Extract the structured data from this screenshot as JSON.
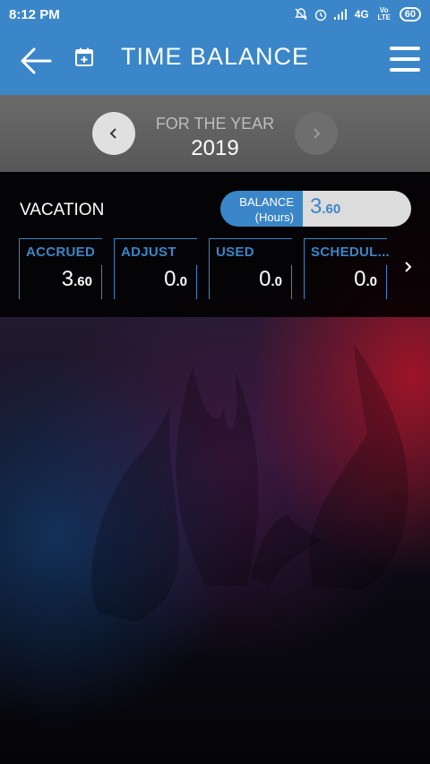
{
  "status_bar": {
    "time": "8:12 PM",
    "network": "4G",
    "volte": "Vo LTE",
    "battery": "60"
  },
  "header": {
    "title": "TIME BALANCE",
    "back_icon": "arrow-left-icon",
    "calendar_icon": "calendar-add-icon",
    "menu_icon": "hamburger-menu-icon"
  },
  "year_selector": {
    "label": "FOR THE YEAR",
    "year": "2019"
  },
  "balance_card": {
    "type": "VACATION",
    "balance_label_line1": "BALANCE",
    "balance_label_line2": "(Hours)",
    "balance_whole": "3",
    "balance_fraction": ".60",
    "columns": [
      {
        "label": "ACCRUED",
        "whole": "3",
        "fraction": ".60"
      },
      {
        "label": "ADJUST",
        "whole": "0",
        "fraction": ".0"
      },
      {
        "label": "USED",
        "whole": "0",
        "fraction": ".0"
      },
      {
        "label": "SCHEDUL...",
        "whole": "0",
        "fraction": ".0"
      }
    ]
  },
  "colors": {
    "accent": "#3a86c8",
    "card_bg": "#000000",
    "year_bar": "#616161"
  }
}
